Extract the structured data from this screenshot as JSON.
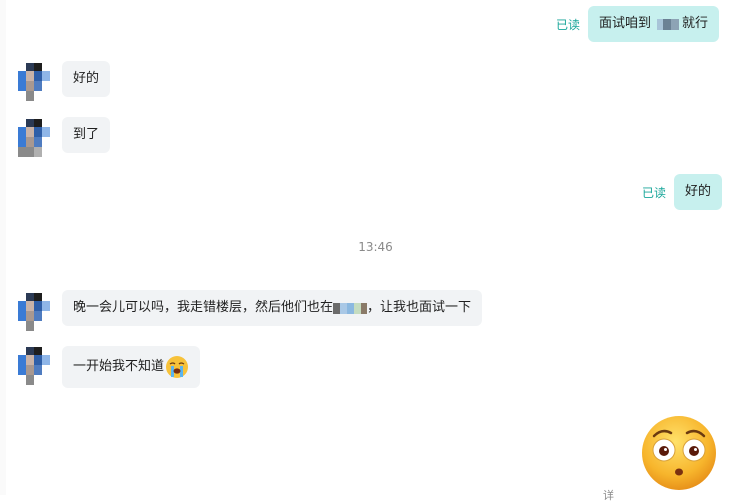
{
  "messages": [
    {
      "side": "out",
      "text_before": "面试咱到",
      "text_after": "就行",
      "read": "已读"
    },
    {
      "side": "in",
      "text": "好的"
    },
    {
      "side": "in",
      "text": "到了"
    },
    {
      "side": "out",
      "text": "好的",
      "read": "已读"
    },
    {
      "side": "in",
      "text_before": "晚一会儿可以吗，我走错楼层，然后他们也在",
      "text_after": "，让我也面试一下"
    },
    {
      "side": "in",
      "text": "一开始我不知道"
    }
  ],
  "timestamp": "13:46",
  "bottom_partial": "详"
}
